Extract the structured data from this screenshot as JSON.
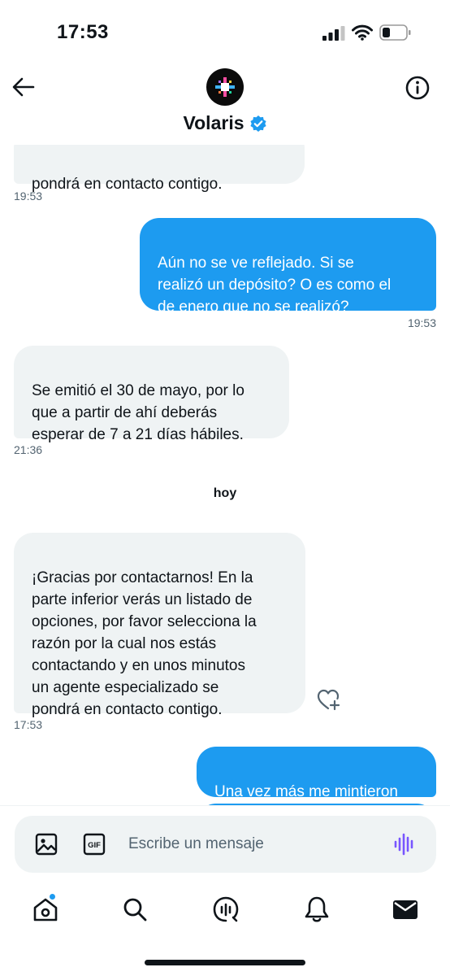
{
  "status": {
    "time": "17:53"
  },
  "header": {
    "title": "Volaris"
  },
  "messages": [
    {
      "text": "pondrá en contacto contigo.",
      "time": "19:53"
    },
    {
      "text": "Aún no se ve reflejado. Si se\nrealizó un depósito? O es como el\nde enero que no se realizó?",
      "time": "19:53"
    },
    {
      "text": "Se emitió el 30 de mayo, por lo\nque a partir de ahí deberás\nesperar de 7 a 21 días hábiles.",
      "time": "21:36"
    },
    {
      "text": "¡Gracias por contactarnos! En la\nparte inferior verás un listado de\nopciones, por favor selecciona la\nrazón por la cual nos estás\ncontactando y en unos minutos\nun agente especializado se\npondrá en contacto contigo.",
      "time": "17:53"
    },
    {
      "text": "Una vez más me mintieron"
    }
  ],
  "day_separator": "hoy",
  "composer": {
    "placeholder": "Escribe un mensaje",
    "gif_label": "GIF"
  },
  "colors": {
    "accent": "#1d9bf0",
    "incoming_bubble": "#eff3f4",
    "voice": "#7856ff"
  },
  "icons": {
    "back": "arrow-left-icon",
    "info": "info-icon",
    "verified": "verified-badge-icon",
    "react": "heart-plus-icon",
    "media": "image-icon",
    "gif": "gif-icon",
    "voice": "voice-wave-icon",
    "tabs": [
      "home-icon",
      "search-icon",
      "spaces-icon",
      "bell-icon",
      "mail-icon"
    ]
  }
}
